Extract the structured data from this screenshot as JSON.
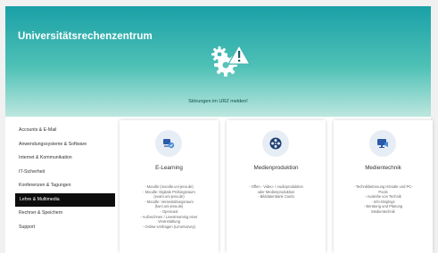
{
  "header": {
    "site_title": "Universitätsrechenzentrum",
    "alert_text": "Störungen im URZ melden!"
  },
  "sidebar": {
    "items": [
      {
        "label": "Accounts & E-Mail"
      },
      {
        "label": "Anwendungssysteme & Software"
      },
      {
        "label": "Internet & Kommunikation"
      },
      {
        "label": "IT-Sicherheit"
      },
      {
        "label": "Konferenzen & Tagungen"
      },
      {
        "label": "Lehre & Multimedia",
        "active": true
      },
      {
        "label": "Rechner & Speichern"
      },
      {
        "label": "Support"
      }
    ]
  },
  "cards": [
    {
      "title": "E-Learning",
      "icon": "elearning-icon",
      "items": [
        "- Moodle (moodle.uni-jena.de)",
        "- Moodle: Digitale Prüfungsraum",
        "(exam.uni-jena.de)",
        "- Moodle: Veranstaltungsraum",
        "(kurs.uni-jena.de)",
        "- Opencast",
        "- Aufzeichnen / Livestreaming einer",
        "Veranstaltung",
        "- Online-Umfragen (LimeSurvey)"
      ]
    },
    {
      "title": "Medienproduktion",
      "icon": "film-reel-icon",
      "items": [
        "- Offen - Video- / Audioproduktion",
        "oder Medienproduktion",
        "- Bilddatenbank Cardo"
      ]
    },
    {
      "title": "Medientechnik",
      "icon": "media-tech-icon",
      "items": [
        "- Technikbetreuung Hörsäle und PC-",
        "Pools",
        "- Ausleihe von Technik",
        "- Info-Displays",
        "- Beratung und Planung",
        "Medientechnik"
      ]
    }
  ],
  "colors": {
    "hero_top": "#1aa0a7",
    "hero_bottom": "#bde7df",
    "active_nav_bg": "#0d0d0d",
    "icon_bg": "#e7edf5",
    "icon_accent": "#2b5aa8"
  }
}
